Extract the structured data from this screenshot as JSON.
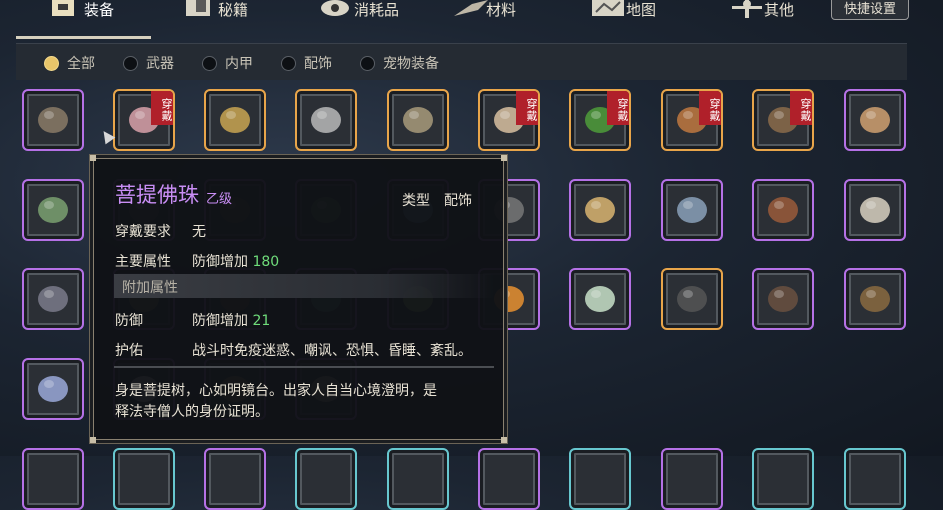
{
  "tabs": [
    {
      "label": "装备",
      "icon": "chest-icon"
    },
    {
      "label": "秘籍",
      "icon": "book-icon"
    },
    {
      "label": "消耗品",
      "icon": "eye-icon"
    },
    {
      "label": "材料",
      "icon": "material-icon"
    },
    {
      "label": "地图",
      "icon": "map-icon"
    },
    {
      "label": "其他",
      "icon": "scarecrow-icon"
    }
  ],
  "settings_label": "快捷设置",
  "filters": [
    {
      "label": "全部",
      "selected": true
    },
    {
      "label": "武器",
      "selected": false
    },
    {
      "label": "内甲",
      "selected": false
    },
    {
      "label": "配饰",
      "selected": false
    },
    {
      "label": "宠物装备",
      "selected": false
    }
  ],
  "worn_badge": "穿戴",
  "items": [
    {
      "name": "bead-necklace-icon",
      "worn": false
    },
    {
      "name": "curved-dagger-icon",
      "worn": true
    },
    {
      "name": "sword-icon",
      "worn": false
    },
    {
      "name": "spear-icon",
      "worn": false
    },
    {
      "name": "trident-icon",
      "worn": false
    },
    {
      "name": "fang-blade-icon",
      "worn": true
    },
    {
      "name": "green-armor-icon",
      "worn": true
    },
    {
      "name": "gauntlet-icon",
      "worn": true
    },
    {
      "name": "amulet-icon",
      "worn": true
    },
    {
      "name": "blade-icon",
      "worn": false
    },
    {
      "name": "red-tassel-spear-icon",
      "worn": false
    },
    {
      "name": "dark-rod-icon",
      "worn": false
    },
    {
      "name": "staff-icon",
      "worn": false
    },
    {
      "name": "green-item-icon",
      "worn": false
    },
    {
      "name": "blue-spear-icon",
      "worn": false
    },
    {
      "name": "iron-baton-icon",
      "worn": false
    },
    {
      "name": "horn-icon",
      "worn": false
    },
    {
      "name": "chain-vest-icon",
      "worn": false
    },
    {
      "name": "leather-armor-icon",
      "worn": false
    },
    {
      "name": "bone-icon",
      "worn": false
    },
    {
      "name": "mist-icon",
      "worn": false
    },
    {
      "name": "herb-pouch-icon",
      "worn": false
    },
    {
      "name": "ore-icon",
      "worn": false
    },
    {
      "name": "leaf-icon",
      "worn": false
    },
    {
      "name": "green-gem-icon",
      "worn": false
    },
    {
      "name": "eye-orb-icon",
      "worn": false
    },
    {
      "name": "pearl-icon",
      "worn": false
    },
    {
      "name": "stone-icon",
      "worn": false
    },
    {
      "name": "jar-icon",
      "worn": false
    },
    {
      "name": "box-icon",
      "worn": false
    },
    {
      "name": "pendant-icon",
      "worn": false
    },
    {
      "name": "feather-icon",
      "worn": false
    },
    {
      "name": "scroll-icon",
      "worn": false
    },
    {
      "name": "charm-icon",
      "worn": false
    }
  ],
  "tooltip": {
    "name": "菩提佛珠",
    "grade": "乙级",
    "type_label": "类型",
    "type_value": "配饰",
    "req_label": "穿戴要求",
    "req_value": "无",
    "main_label": "主要属性",
    "main_text": "防御增加",
    "main_num": "180",
    "extra_section": "附加属性",
    "def_label": "防御",
    "def_text": "防御增加",
    "def_num": "21",
    "protect_label": "护佑",
    "protect_value": "战斗时免疫迷惑、嘲讽、恐惧、昏睡、紊乱。",
    "desc_line1": "身是菩提树，心如明镜台。出家人自当心境澄明，是",
    "desc_line2": "释法寺僧人的身份证明。"
  },
  "colors": {
    "accent_purple": "#c98ef5",
    "bonus_green": "#6fdc7a",
    "worn_red": "#b0202a"
  }
}
